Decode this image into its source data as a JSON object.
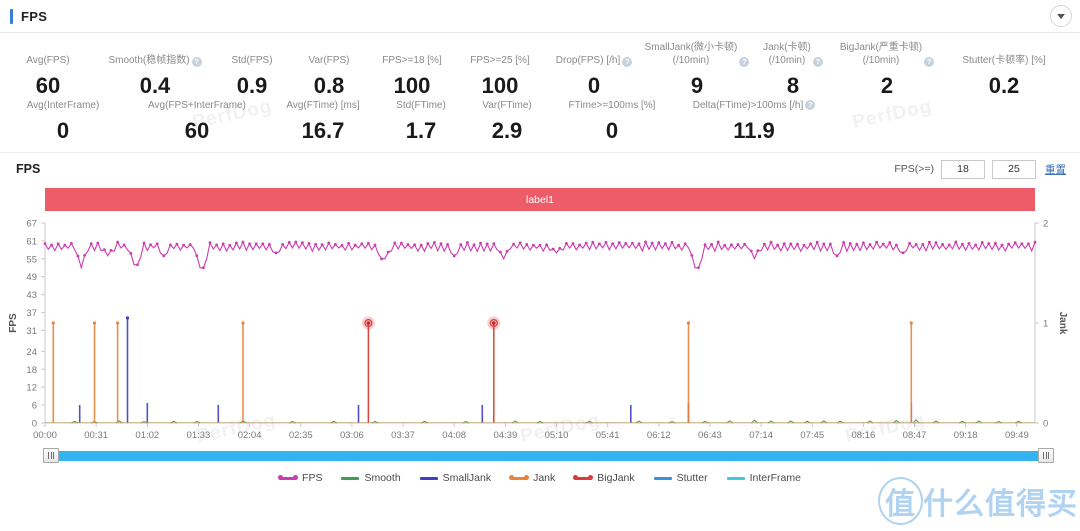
{
  "header": {
    "title": "FPS",
    "collapse_icon": "chevron-down-icon"
  },
  "metrics": {
    "row1": [
      {
        "label": "Avg(FPS)",
        "label2": "",
        "value": "60",
        "help": false
      },
      {
        "label": "Smooth(稳帧指数)",
        "label2": "",
        "value": "0.4",
        "help": true
      },
      {
        "label": "Std(FPS)",
        "label2": "",
        "value": "0.9",
        "help": false
      },
      {
        "label": "Var(FPS)",
        "label2": "",
        "value": "0.8",
        "help": false
      },
      {
        "label": "FPS>=18 [%]",
        "label2": "",
        "value": "100",
        "help": false
      },
      {
        "label": "FPS>=25 [%]",
        "label2": "",
        "value": "100",
        "help": false
      },
      {
        "label": "Drop(FPS) [/h]",
        "label2": "",
        "value": "0",
        "help": true
      },
      {
        "label": "SmallJank(微小卡顿)",
        "label2": "(/10min)",
        "value": "9",
        "help": true
      },
      {
        "label": "Jank(卡顿)",
        "label2": "(/10min)",
        "value": "8",
        "help": true
      },
      {
        "label": "BigJank(严重卡顿)",
        "label2": "(/10min)",
        "value": "2",
        "help": true
      },
      {
        "label": "Stutter(卡顿率) [%]",
        "label2": "",
        "value": "0.2",
        "help": false
      }
    ],
    "row2": [
      {
        "label": "Avg(InterFrame)",
        "value": "0",
        "help": false
      },
      {
        "label": "Avg(FPS+InterFrame)",
        "value": "60",
        "help": false
      },
      {
        "label": "Avg(FTime) [ms]",
        "value": "16.7",
        "help": false
      },
      {
        "label": "Std(FTime)",
        "value": "1.7",
        "help": false
      },
      {
        "label": "Var(FTime)",
        "value": "2.9",
        "help": false
      },
      {
        "label": "FTime>=100ms [%]",
        "value": "0",
        "help": false
      },
      {
        "label": "Delta(FTime)>100ms [/h]",
        "value": "11.9",
        "help": true
      }
    ]
  },
  "chart_panel": {
    "title": "FPS",
    "fps_ge_label": "FPS(>=)",
    "threshold_low": "18",
    "threshold_high": "25",
    "reset_label": "重置",
    "banner_label": "label1",
    "banner_color": "#ec5d69"
  },
  "chart_data": {
    "type": "line",
    "title": "FPS",
    "xlabel": "",
    "ylabel": "FPS",
    "y2label": "Jank",
    "ylim": [
      0,
      67
    ],
    "y2lim": [
      0,
      2
    ],
    "grid": false,
    "legend_position": "bottom",
    "yticks": [
      0,
      6,
      12,
      18,
      24,
      31,
      37,
      43,
      49,
      55,
      61,
      67
    ],
    "y2ticks": [
      0,
      1,
      2
    ],
    "xticks": [
      "00:00",
      "00:31",
      "01:02",
      "01:33",
      "02:04",
      "02:35",
      "03:06",
      "03:37",
      "04:08",
      "04:39",
      "05:10",
      "05:41",
      "06:12",
      "06:43",
      "07:14",
      "07:45",
      "08:16",
      "08:47",
      "09:18",
      "09:49"
    ],
    "x_range_seconds": [
      0,
      600
    ],
    "series": [
      {
        "name": "FPS",
        "color": "#cc3bb0",
        "axis": "left",
        "baseline": 59,
        "dips": [
          [
            22,
            52
          ],
          [
            38,
            56
          ],
          [
            55,
            53
          ],
          [
            72,
            56
          ],
          [
            95,
            52
          ],
          [
            140,
            57
          ],
          [
            205,
            55
          ],
          [
            248,
            56
          ],
          [
            278,
            55
          ],
          [
            310,
            57
          ],
          [
            395,
            52
          ],
          [
            430,
            55
          ],
          [
            480,
            56
          ],
          [
            520,
            57
          ]
        ]
      },
      {
        "name": "Smooth",
        "color": "#3f9e53",
        "axis": "right",
        "spikes": [
          [
            18,
            0.12
          ],
          [
            30,
            0.1
          ],
          [
            45,
            0.15
          ],
          [
            60,
            0.1
          ],
          [
            78,
            0.12
          ],
          [
            92,
            0.1
          ],
          [
            120,
            0.14
          ],
          [
            150,
            0.1
          ],
          [
            175,
            0.12
          ],
          [
            200,
            0.1
          ],
          [
            230,
            0.12
          ],
          [
            255,
            0.1
          ],
          [
            285,
            0.14
          ],
          [
            300,
            0.1
          ],
          [
            330,
            0.12
          ],
          [
            360,
            0.14
          ],
          [
            380,
            0.1
          ],
          [
            400,
            0.12
          ],
          [
            415,
            0.16
          ],
          [
            430,
            0.2
          ],
          [
            440,
            0.14
          ],
          [
            452,
            0.16
          ],
          [
            462,
            0.13
          ],
          [
            472,
            0.15
          ],
          [
            482,
            0.13
          ],
          [
            500,
            0.14
          ],
          [
            516,
            0.18
          ],
          [
            528,
            0.22
          ],
          [
            540,
            0.14
          ],
          [
            556,
            0.12
          ],
          [
            566,
            0.14
          ],
          [
            578,
            0.1
          ],
          [
            590,
            0.12
          ]
        ]
      },
      {
        "name": "SmallJank",
        "color": "#3f3fbf",
        "axis": "right",
        "spikes": [
          [
            50,
            1.05
          ],
          [
            21,
            0.18
          ],
          [
            62,
            0.2
          ],
          [
            105,
            0.18
          ],
          [
            190,
            0.18
          ],
          [
            265,
            0.18
          ],
          [
            355,
            0.18
          ],
          [
            390,
            0.2
          ],
          [
            525,
            0.2
          ]
        ]
      },
      {
        "name": "Jank",
        "color": "#e8843c",
        "axis": "right",
        "spikes": [
          [
            5,
            1.0
          ],
          [
            30,
            1.0
          ],
          [
            44,
            1.0
          ],
          [
            120,
            1.0
          ],
          [
            196,
            1.0
          ],
          [
            272,
            1.0
          ],
          [
            390,
            1.0
          ],
          [
            525,
            1.0
          ]
        ]
      },
      {
        "name": "BigJank",
        "color": "#d93a3a",
        "axis": "right",
        "spikes": [
          [
            196,
            1.0
          ],
          [
            272,
            1.0
          ]
        ],
        "highlighted": [
          [
            196,
            1.0
          ],
          [
            272,
            1.0
          ]
        ]
      },
      {
        "name": "Stutter",
        "color": "#3f8fe0",
        "axis": "right",
        "spikes": []
      },
      {
        "name": "InterFrame",
        "color": "#3fc9d9",
        "axis": "right",
        "spikes": []
      }
    ],
    "legend": [
      {
        "label": "FPS",
        "color": "#cc3bb0",
        "dotted": true
      },
      {
        "label": "Smooth",
        "color": "#3f9e53",
        "dotted": false
      },
      {
        "label": "SmallJank",
        "color": "#3f3fbf",
        "dotted": false
      },
      {
        "label": "Jank",
        "color": "#e8843c",
        "dotted": true
      },
      {
        "label": "BigJank",
        "color": "#d93a3a",
        "dotted": true
      },
      {
        "label": "Stutter",
        "color": "#3f8fe0",
        "dotted": false
      },
      {
        "label": "InterFrame",
        "color": "#3fc9d9",
        "dotted": false
      }
    ]
  },
  "watermarks": {
    "perfdog": "PerfDog",
    "corner": "什么值得买",
    "corner_mark": "值"
  }
}
